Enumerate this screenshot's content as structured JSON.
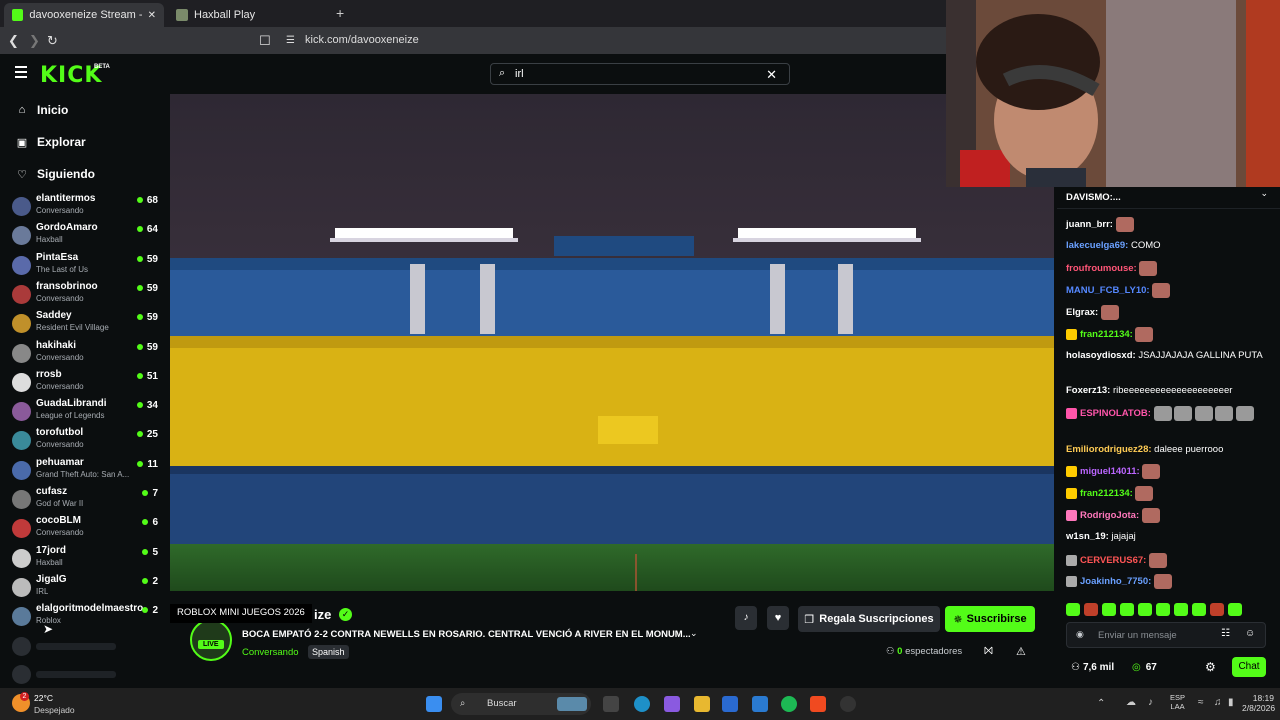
{
  "browser": {
    "tabs": [
      {
        "title": "davooxeneize Stream - Watch Li",
        "active": true,
        "favicon_color": "#53fc18"
      },
      {
        "title": "Haxball Play",
        "active": false,
        "favicon_color": "#7a8a6a"
      }
    ],
    "new_tab_symbol": "+",
    "close_symbol": "✕",
    "url": "kick.com/davooxeneize"
  },
  "kick": {
    "logo": "KICK",
    "beta": "BETA",
    "search_value": "irl",
    "accent_color": "#53fc18",
    "nav": [
      {
        "label": "Inicio",
        "icon": "home-icon"
      },
      {
        "label": "Explorar",
        "icon": "compass-icon"
      },
      {
        "label": "Siguiendo",
        "icon": "heart-icon"
      }
    ],
    "channels": [
      {
        "name": "elantitermos",
        "category": "Conversando",
        "viewers": "68",
        "color": "#4a5a8a"
      },
      {
        "name": "GordoAmaro",
        "category": "Haxball",
        "viewers": "64",
        "color": "#6a7a9a"
      },
      {
        "name": "PintaEsa",
        "category": "The Last of Us",
        "viewers": "59",
        "color": "#5a6aaa"
      },
      {
        "name": "fransobrinoo",
        "category": "Conversando",
        "viewers": "59",
        "color": "#aa3a3a"
      },
      {
        "name": "Saddey",
        "category": "Resident Evil Village",
        "viewers": "59",
        "color": "#c0902a"
      },
      {
        "name": "hakihaki",
        "category": "Conversando",
        "viewers": "59",
        "color": "#888"
      },
      {
        "name": "rrosb",
        "category": "Conversando",
        "viewers": "51",
        "color": "#ddd"
      },
      {
        "name": "GuadaLibrandi",
        "category": "League of Legends",
        "viewers": "34",
        "color": "#8a5a9a"
      },
      {
        "name": "torofutbol",
        "category": "Conversando",
        "viewers": "25",
        "color": "#3a8a9a"
      },
      {
        "name": "pehuamar",
        "category": "Grand Theft Auto: San A...",
        "viewers": "11",
        "color": "#4a6aaa"
      },
      {
        "name": "cufasz",
        "category": "God of War II",
        "viewers": "7",
        "color": "#777"
      },
      {
        "name": "cocoBLM",
        "category": "Conversando",
        "viewers": "6",
        "color": "#c03a3a"
      },
      {
        "name": "17jord",
        "category": "Haxball",
        "viewers": "5",
        "color": "#ccc"
      },
      {
        "name": "JigalG",
        "category": "IRL",
        "viewers": "2",
        "color": "#bbb"
      },
      {
        "name": "elalgoritmodelmaestro",
        "category": "Roblox",
        "viewers": "2",
        "color": "#5a7a9a"
      }
    ],
    "tooltip": "ROBLOX MINI JUEGOS 2026",
    "stream": {
      "name_suffix": "ize",
      "title": "BOCA EMPATÓ 2-2 CONTRA NEWELLS EN ROSARIO. CENTRAL VENCIÓ A RIVER EN EL MONUM...",
      "category": "Conversando",
      "language": "Spanish",
      "live_badge": "LIVE",
      "viewers_count": "0",
      "viewers_label": "espectadores",
      "gift_button": "Regala Suscripciones",
      "subscribe_button": "Suscribirse"
    },
    "chat": {
      "pinned_line1": "DAVISMO:...",
      "messages": [
        {
          "user": "juann_brr:",
          "text": "",
          "color": "#ffffff",
          "emote": true
        },
        {
          "user": "lakecuelga69:",
          "text": "COMO",
          "color": "#6aa0ff",
          "emote": false
        },
        {
          "user": "froufroumouse:",
          "text": "",
          "color": "#ff5577",
          "emote": true
        },
        {
          "user": "MANU_FCB_LY10:",
          "text": "",
          "color": "#5588ff",
          "emote": true
        },
        {
          "user": "Elgrax:",
          "text": "",
          "color": "#ffffff",
          "emote": true
        },
        {
          "user": "fran212134:",
          "text": "",
          "color": "#53fc18",
          "emote": true
        },
        {
          "user": "holasoydiosxd:",
          "text": "JSAJJAJAJA GALLINA PUTA",
          "color": "#ffffff",
          "emote": false
        },
        {
          "user": "Foxerz13:",
          "text": "ribeeeeeeeeeeeeeeeeeeeer",
          "color": "#ffffff",
          "emote": false
        },
        {
          "user": "ESPINOLATOB:",
          "text": "",
          "color": "#ff55aa",
          "emote": true
        },
        {
          "user": "Emiliorodriguez28:",
          "text": "daleee puerrooo",
          "color": "#ffcc55",
          "emote": false
        },
        {
          "user": "miguel14011:",
          "text": "",
          "color": "#bb66ff",
          "emote": true
        },
        {
          "user": "fran212134:",
          "text": "",
          "color": "#53fc18",
          "emote": true
        },
        {
          "user": "RodrigoJota:",
          "text": "",
          "color": "#ff77bb",
          "emote": true
        },
        {
          "user": "w1sn_19:",
          "text": "jajajaj",
          "color": "#ffffff",
          "emote": false
        },
        {
          "user": "CERVERUS67:",
          "text": "",
          "color": "#ff5555",
          "emote": true
        },
        {
          "user": "Joakinho_7750:",
          "text": "",
          "color": "#6aa0ff",
          "emote": true
        }
      ],
      "input_placeholder": "Enviar un mensaje",
      "points_a": "7,6 mil",
      "points_b": "67",
      "chat_button": "Chat"
    }
  },
  "taskbar": {
    "weather_temp": "22°C",
    "weather_desc": "Despejado",
    "weather_badge": "2",
    "search_placeholder": "Buscar",
    "lang_top": "ESP",
    "lang_bottom": "LAA",
    "time": "18:19",
    "date": "2/8/2026"
  }
}
